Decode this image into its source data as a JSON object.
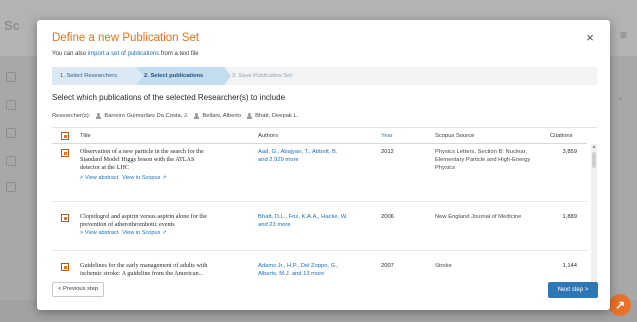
{
  "background": {
    "brand": "Sc",
    "menu_icon": "≡",
    "fab_icon": "↗"
  },
  "modal": {
    "title": "Define a new Publication Set",
    "subtitle_prefix": "You can also",
    "subtitle_link": "import a set of publications",
    "subtitle_suffix": "from a text file",
    "close_icon": "×",
    "steps": [
      {
        "label": "1. Select Researchers",
        "state": "done"
      },
      {
        "label": "2. Select publications",
        "state": "active"
      },
      {
        "label": "3. Save Publication Set",
        "state": "pending"
      }
    ],
    "instruction": "Select which publications of the selected Researcher(s) to include",
    "researchers_label": "Researcher(s):",
    "researchers": [
      "Barreiro Guimarães Da Costa, J.",
      "Bellani, Alberto",
      "Bhatt, Deepak L."
    ],
    "table": {
      "columns": {
        "title": "Title",
        "authors": "Authors",
        "year": "Year",
        "source": "Scopus Source",
        "citations": "Citations"
      },
      "rows": [
        {
          "title_l1": "Observation of a new particle in the search for the",
          "title_l2": "Standard Model Higgs boson with the ATLAS",
          "title_l3": "detector at the LHC",
          "authors_l1": "Aad, G., Abajyan, T., Abbott, B.",
          "authors_l2": "and 2,929 more",
          "year": "2012",
          "source_l1": "Physics Letters, Section B: Nuclear,",
          "source_l2": "Elementary Particle and High-Energy",
          "source_l3": "Physics",
          "citations": "3,859",
          "view_abstract": "> View abstract",
          "view_scopus": "View in Scopus ↗"
        },
        {
          "title_l1": "Clopidogrel and aspirin versus aspirin alone for the",
          "title_l2": "prevention of atherothrombotic events",
          "authors_l1": "Bhatt, D.L., Fox, K.A.A., Hacke, W.",
          "authors_l2": "and 23 more",
          "year": "2006",
          "source_l1": "New England Journal of Medicine",
          "citations": "1,889",
          "view_abstract": "> View abstract",
          "view_scopus": "View in Scopus ↗"
        },
        {
          "title_l1": "Guidelines for the early management of adults with",
          "title_l2": "ischemic stroke: A guideline from the American...",
          "authors_l1": "Adams Jr., H.P., Del Zoppo, G.,",
          "authors_l2": "Alberts, M.J. and 13 more",
          "year": "2007",
          "source_l1": "Stroke",
          "citations": "1,144"
        }
      ]
    },
    "prev_button": "< Previous step",
    "next_button": "Next step >"
  },
  "colors": {
    "accent_orange": "#e9711c",
    "link_blue": "#1d6fb8",
    "primary_button": "#2e77b5"
  }
}
